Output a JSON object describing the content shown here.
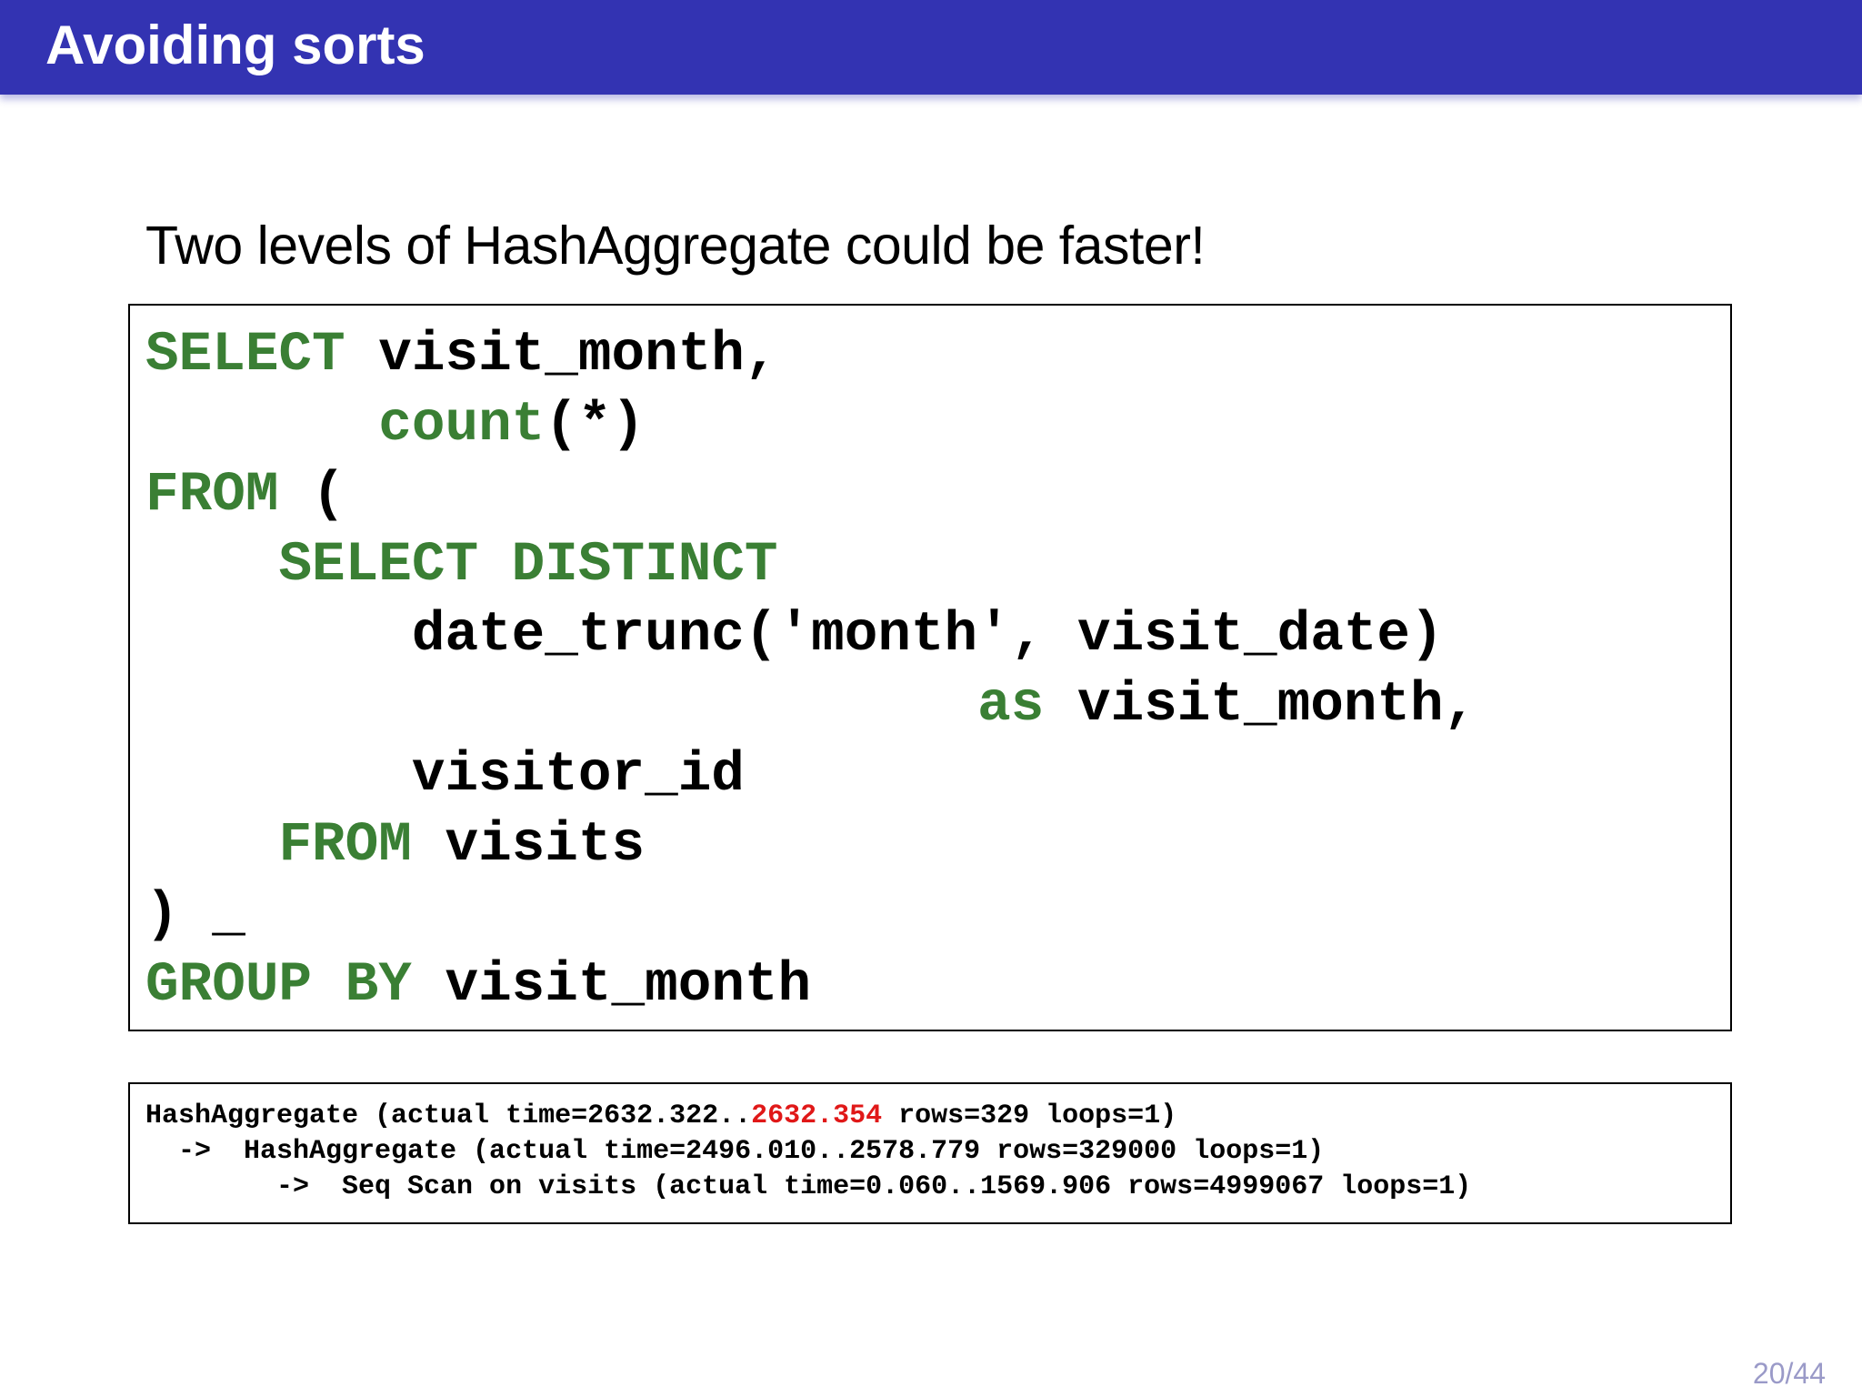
{
  "header": {
    "title": "Avoiding sorts"
  },
  "subtitle": "Two levels of HashAggregate could be faster!",
  "code": {
    "l1_kw": "SELECT",
    "l1_rest": " visit_month,",
    "l2_indent": "       ",
    "l2_kw": "count",
    "l2_rest": "(*)",
    "l3_kw": "FROM",
    "l3_rest": " (",
    "l4_indent": "    ",
    "l4_kw": "SELECT DISTINCT",
    "l5_text": "        date_trunc('month', visit_date)",
    "l6_indent": "                         ",
    "l6_kw": "as",
    "l6_rest": " visit_month,",
    "l7_text": "        visitor_id",
    "l8_indent": "    ",
    "l8_kw": "FROM",
    "l8_rest": " visits",
    "l9_text": ") _",
    "l10_kw": "GROUP BY",
    "l10_rest": " visit_month"
  },
  "plan": {
    "line1_pre": "HashAggregate (actual time=2632.322..",
    "line1_highlight": "2632.354",
    "line1_post": " rows=329 loops=1)",
    "line2": "  ->  HashAggregate (actual time=2496.010..2578.779 rows=329000 loops=1)",
    "line3": "        ->  Seq Scan on visits (actual time=0.060..1569.906 rows=4999067 loops=1)"
  },
  "page_number": "20/44",
  "colors": {
    "header_bg": "#3333b2",
    "keyword": "#3a7f34",
    "highlight": "#e01818"
  }
}
